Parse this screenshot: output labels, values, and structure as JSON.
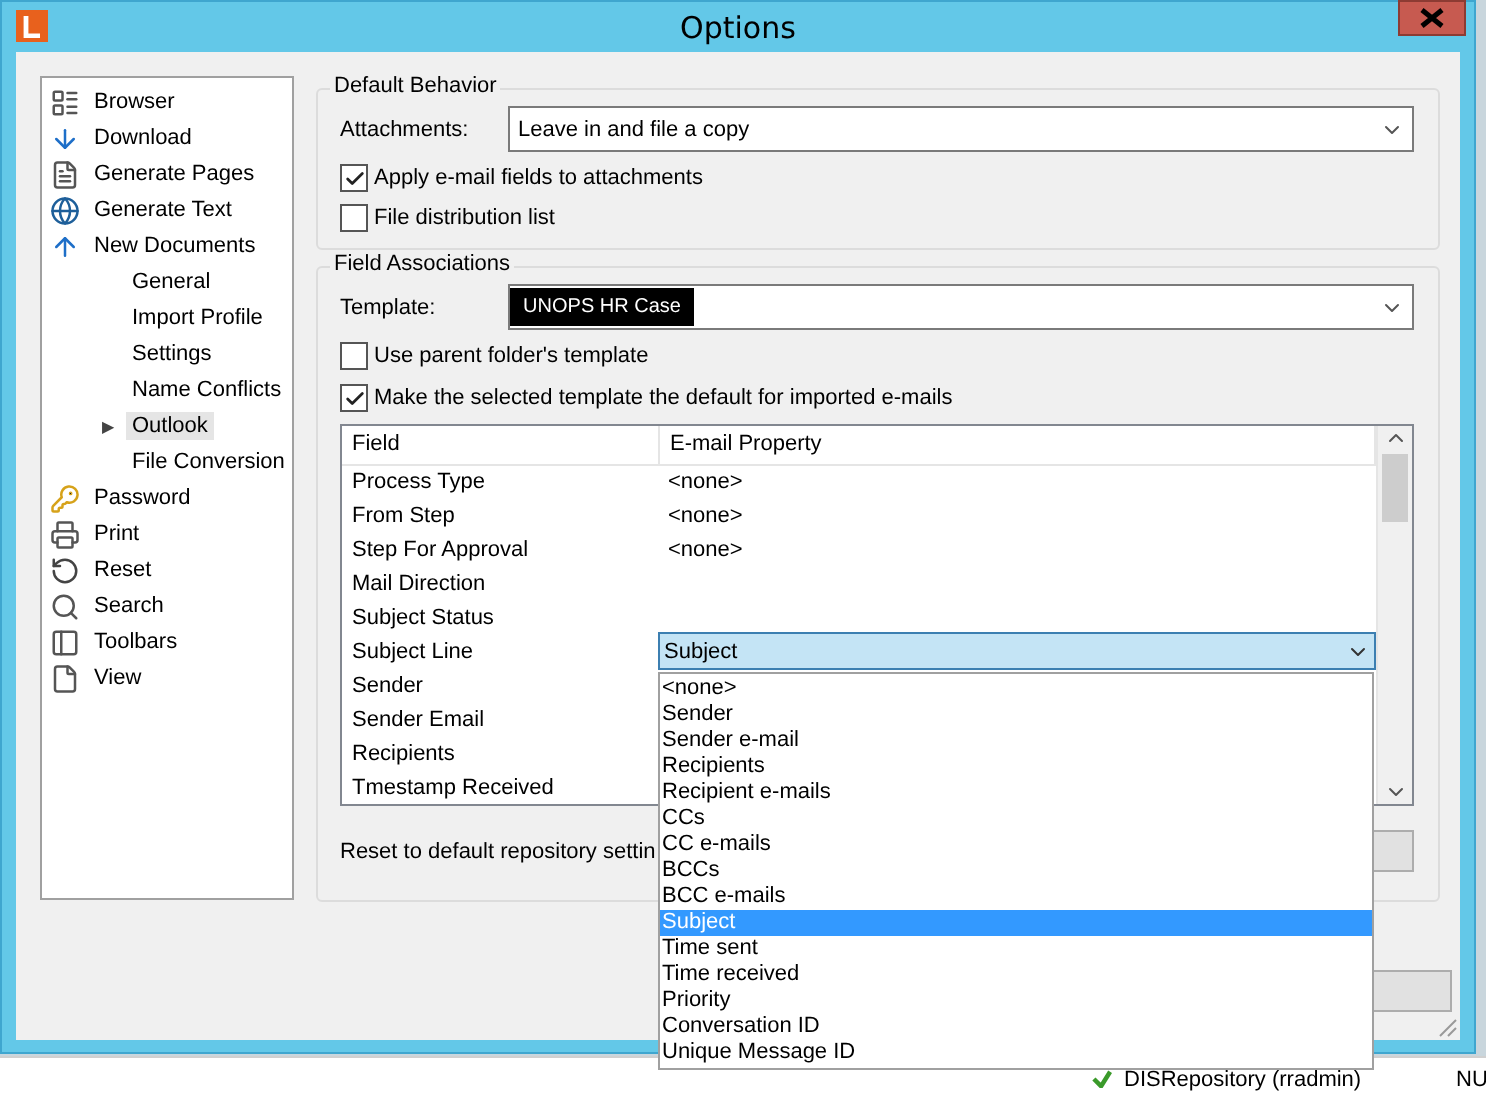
{
  "window": {
    "title": "Options"
  },
  "sidebar": {
    "items": [
      {
        "label": "Browser",
        "selected": false
      },
      {
        "label": "Download",
        "selected": false
      },
      {
        "label": "Generate Pages",
        "selected": false
      },
      {
        "label": "Generate Text",
        "selected": false
      },
      {
        "label": "New Documents",
        "selected": false,
        "children": [
          {
            "label": "General",
            "selected": false
          },
          {
            "label": "Import Profile",
            "selected": false
          },
          {
            "label": "Settings",
            "selected": false
          },
          {
            "label": "Name Conflicts",
            "selected": false
          },
          {
            "label": "Outlook",
            "selected": true,
            "toggle": "▶"
          },
          {
            "label": "File Conversion",
            "selected": false
          }
        ]
      },
      {
        "label": "Password",
        "selected": false
      },
      {
        "label": "Print",
        "selected": false
      },
      {
        "label": "Reset",
        "selected": false
      },
      {
        "label": "Search",
        "selected": false
      },
      {
        "label": "Toolbars",
        "selected": false
      },
      {
        "label": "View",
        "selected": false
      }
    ]
  },
  "default_behavior": {
    "title": "Default Behavior",
    "attachments_label": "Attachments:",
    "attachments_value": "Leave in and file a copy",
    "checkboxes": [
      {
        "label": "Apply e-mail fields to attachments",
        "checked": true
      },
      {
        "label": "File distribution list",
        "checked": false
      }
    ]
  },
  "field_associations": {
    "title": "Field Associations",
    "template_label": "Template:",
    "template_value": "UNOPS HR Case",
    "checkboxes": [
      {
        "label": "Use parent folder's template",
        "checked": false
      },
      {
        "label": "Make the selected template the default for imported e-mails",
        "checked": true
      }
    ],
    "table": {
      "columns": [
        "Field",
        "E-mail Property"
      ],
      "rows": [
        {
          "field": "Process Type",
          "property": "<none>",
          "kind": "text"
        },
        {
          "field": "From Step",
          "property": "<none>",
          "kind": "text"
        },
        {
          "field": "Step For Approval",
          "property": "<none>",
          "kind": "text"
        },
        {
          "field": "Mail Direction",
          "kind": "text"
        },
        {
          "field": "Subject Status",
          "kind": "text"
        },
        {
          "field": "Subject Line",
          "property": "Subject",
          "kind": "combo"
        },
        {
          "field": "Sender",
          "kind": "text"
        },
        {
          "field": "Sender Email",
          "kind": "text"
        },
        {
          "field": "Recipients",
          "kind": "text"
        },
        {
          "field": "Tmestamp Received",
          "kind": "text"
        }
      ]
    },
    "dropdown_options": [
      {
        "label": "<none>",
        "selected": false
      },
      {
        "label": "Sender",
        "selected": false
      },
      {
        "label": "Sender e-mail",
        "selected": false
      },
      {
        "label": "Recipients",
        "selected": false
      },
      {
        "label": "Recipient e-mails",
        "selected": false
      },
      {
        "label": "CCs",
        "selected": false
      },
      {
        "label": "CC e-mails",
        "selected": false
      },
      {
        "label": "BCCs",
        "selected": false
      },
      {
        "label": "BCC e-mails",
        "selected": false
      },
      {
        "label": "Subject",
        "selected": true
      },
      {
        "label": "Time sent",
        "selected": false
      },
      {
        "label": "Time received",
        "selected": false
      },
      {
        "label": "Priority",
        "selected": false
      },
      {
        "label": "Conversation ID",
        "selected": false
      },
      {
        "label": "Unique Message ID",
        "selected": false
      }
    ],
    "reset_label": "Reset to default repository settin"
  },
  "background_status_bar": {
    "repository": "DISRepository (rradmin)",
    "indicator": "NU"
  }
}
